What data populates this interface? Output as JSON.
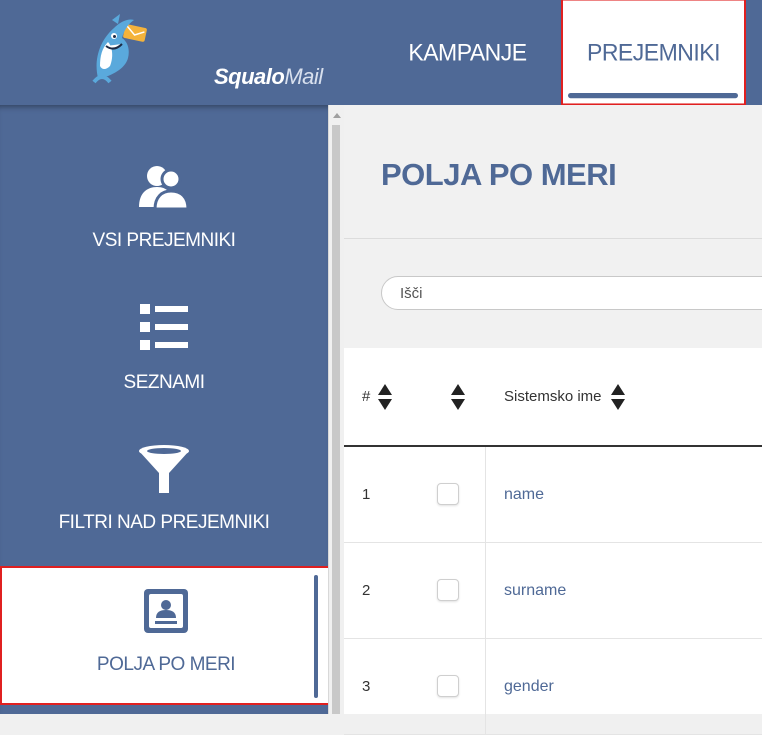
{
  "brand": {
    "name_primary": "Squalo",
    "name_secondary": "Mail"
  },
  "topnav": {
    "tabs": [
      {
        "label": "KAMPANJE",
        "active": false
      },
      {
        "label": "PREJEMNIKI",
        "active": true
      }
    ]
  },
  "sidebar": {
    "items": [
      {
        "label": "VSI PREJEMNIKI",
        "icon": "users-icon",
        "active": false
      },
      {
        "label": "SEZNAMI",
        "icon": "list-icon",
        "active": false
      },
      {
        "label": "FILTRI NAD PREJEMNIKI",
        "icon": "filter-icon",
        "active": false
      },
      {
        "label": "POLJA PO MERI",
        "icon": "contact-card-icon",
        "active": true
      }
    ]
  },
  "main": {
    "title": "POLJA PO MERI",
    "search": {
      "placeholder": "Išči",
      "value": ""
    },
    "table": {
      "columns": [
        {
          "label": "#",
          "sortable": true
        },
        {
          "label": "",
          "sortable": true
        },
        {
          "label": "Sistemsko ime",
          "sortable": true
        }
      ],
      "rows": [
        {
          "num": "1",
          "checked": false,
          "name": "name"
        },
        {
          "num": "2",
          "checked": false,
          "name": "surname"
        },
        {
          "num": "3",
          "checked": false,
          "name": "gender"
        }
      ]
    }
  },
  "colors": {
    "brand_blue": "#4f6996",
    "highlight_red": "#e02020"
  }
}
